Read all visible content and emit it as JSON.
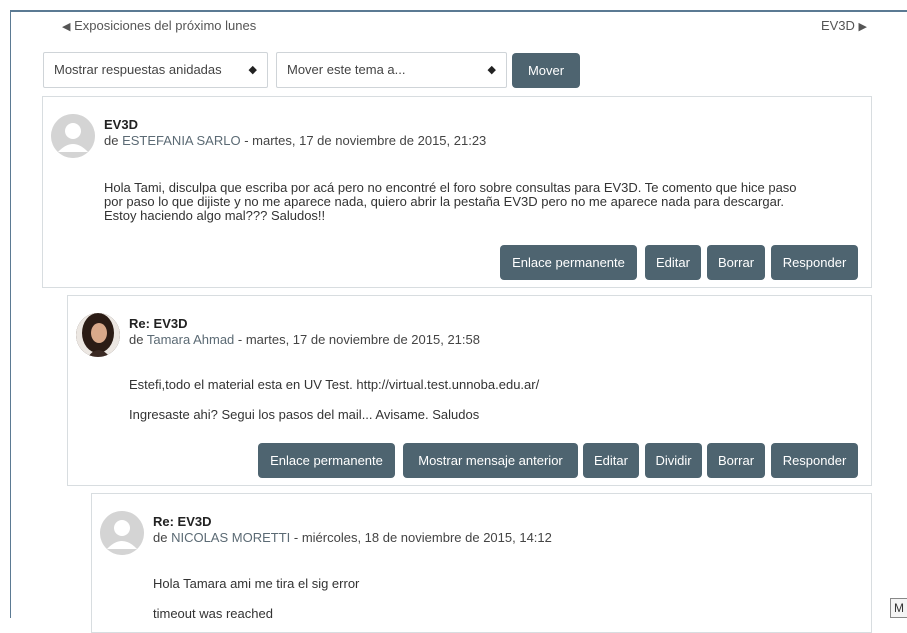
{
  "nav": {
    "prev_label": "Exposiciones del próximo lunes",
    "next_label": "EV3D"
  },
  "controls": {
    "display_mode": "Mostrar respuestas anidadas",
    "move_topic": "Mover este tema a...",
    "move_button": "Mover"
  },
  "posts": [
    {
      "subject": "EV3D",
      "by_prefix": "de ",
      "author": "ESTEFANIA SARLO",
      "date": " - martes, 17 de noviembre de 2015, 21:23",
      "paragraphs": [
        "Hola Tami, disculpa que escriba por acá pero no encontré el foro sobre consultas para EV3D. Te comento que hice paso",
        "por paso lo que dijiste y no me aparece nada, quiero abrir la pestaña EV3D pero no me aparece nada para descargar.",
        "Estoy haciendo algo mal??? Saludos!!"
      ],
      "actions": [
        "Enlace permanente",
        "Editar",
        "Borrar",
        "Responder"
      ]
    },
    {
      "subject": "Re: EV3D",
      "by_prefix": "de ",
      "author": "Tamara Ahmad",
      "date": " - martes, 17 de noviembre de 2015, 21:58",
      "paragraphs": [
        "Estefi,todo el material esta en UV Test. http://virtual.test.unnoba.edu.ar/",
        "Ingresaste ahi? Segui los pasos del mail... Avisame. Saludos"
      ],
      "actions": [
        "Enlace permanente",
        "Mostrar mensaje anterior",
        "Editar",
        "Dividir",
        "Borrar",
        "Responder"
      ]
    },
    {
      "subject": "Re: EV3D",
      "by_prefix": "de ",
      "author": "NICOLAS MORETTI",
      "date": " - miércoles, 18 de noviembre de 2015, 14:12",
      "paragraphs": [
        "Hola Tamara ami me tira el sig error",
        "timeout was reached"
      ]
    }
  ],
  "edge_button": "M",
  "colors": {
    "button": "#4e6470",
    "frame": "#5b7a93",
    "border": "#d8dde0"
  }
}
